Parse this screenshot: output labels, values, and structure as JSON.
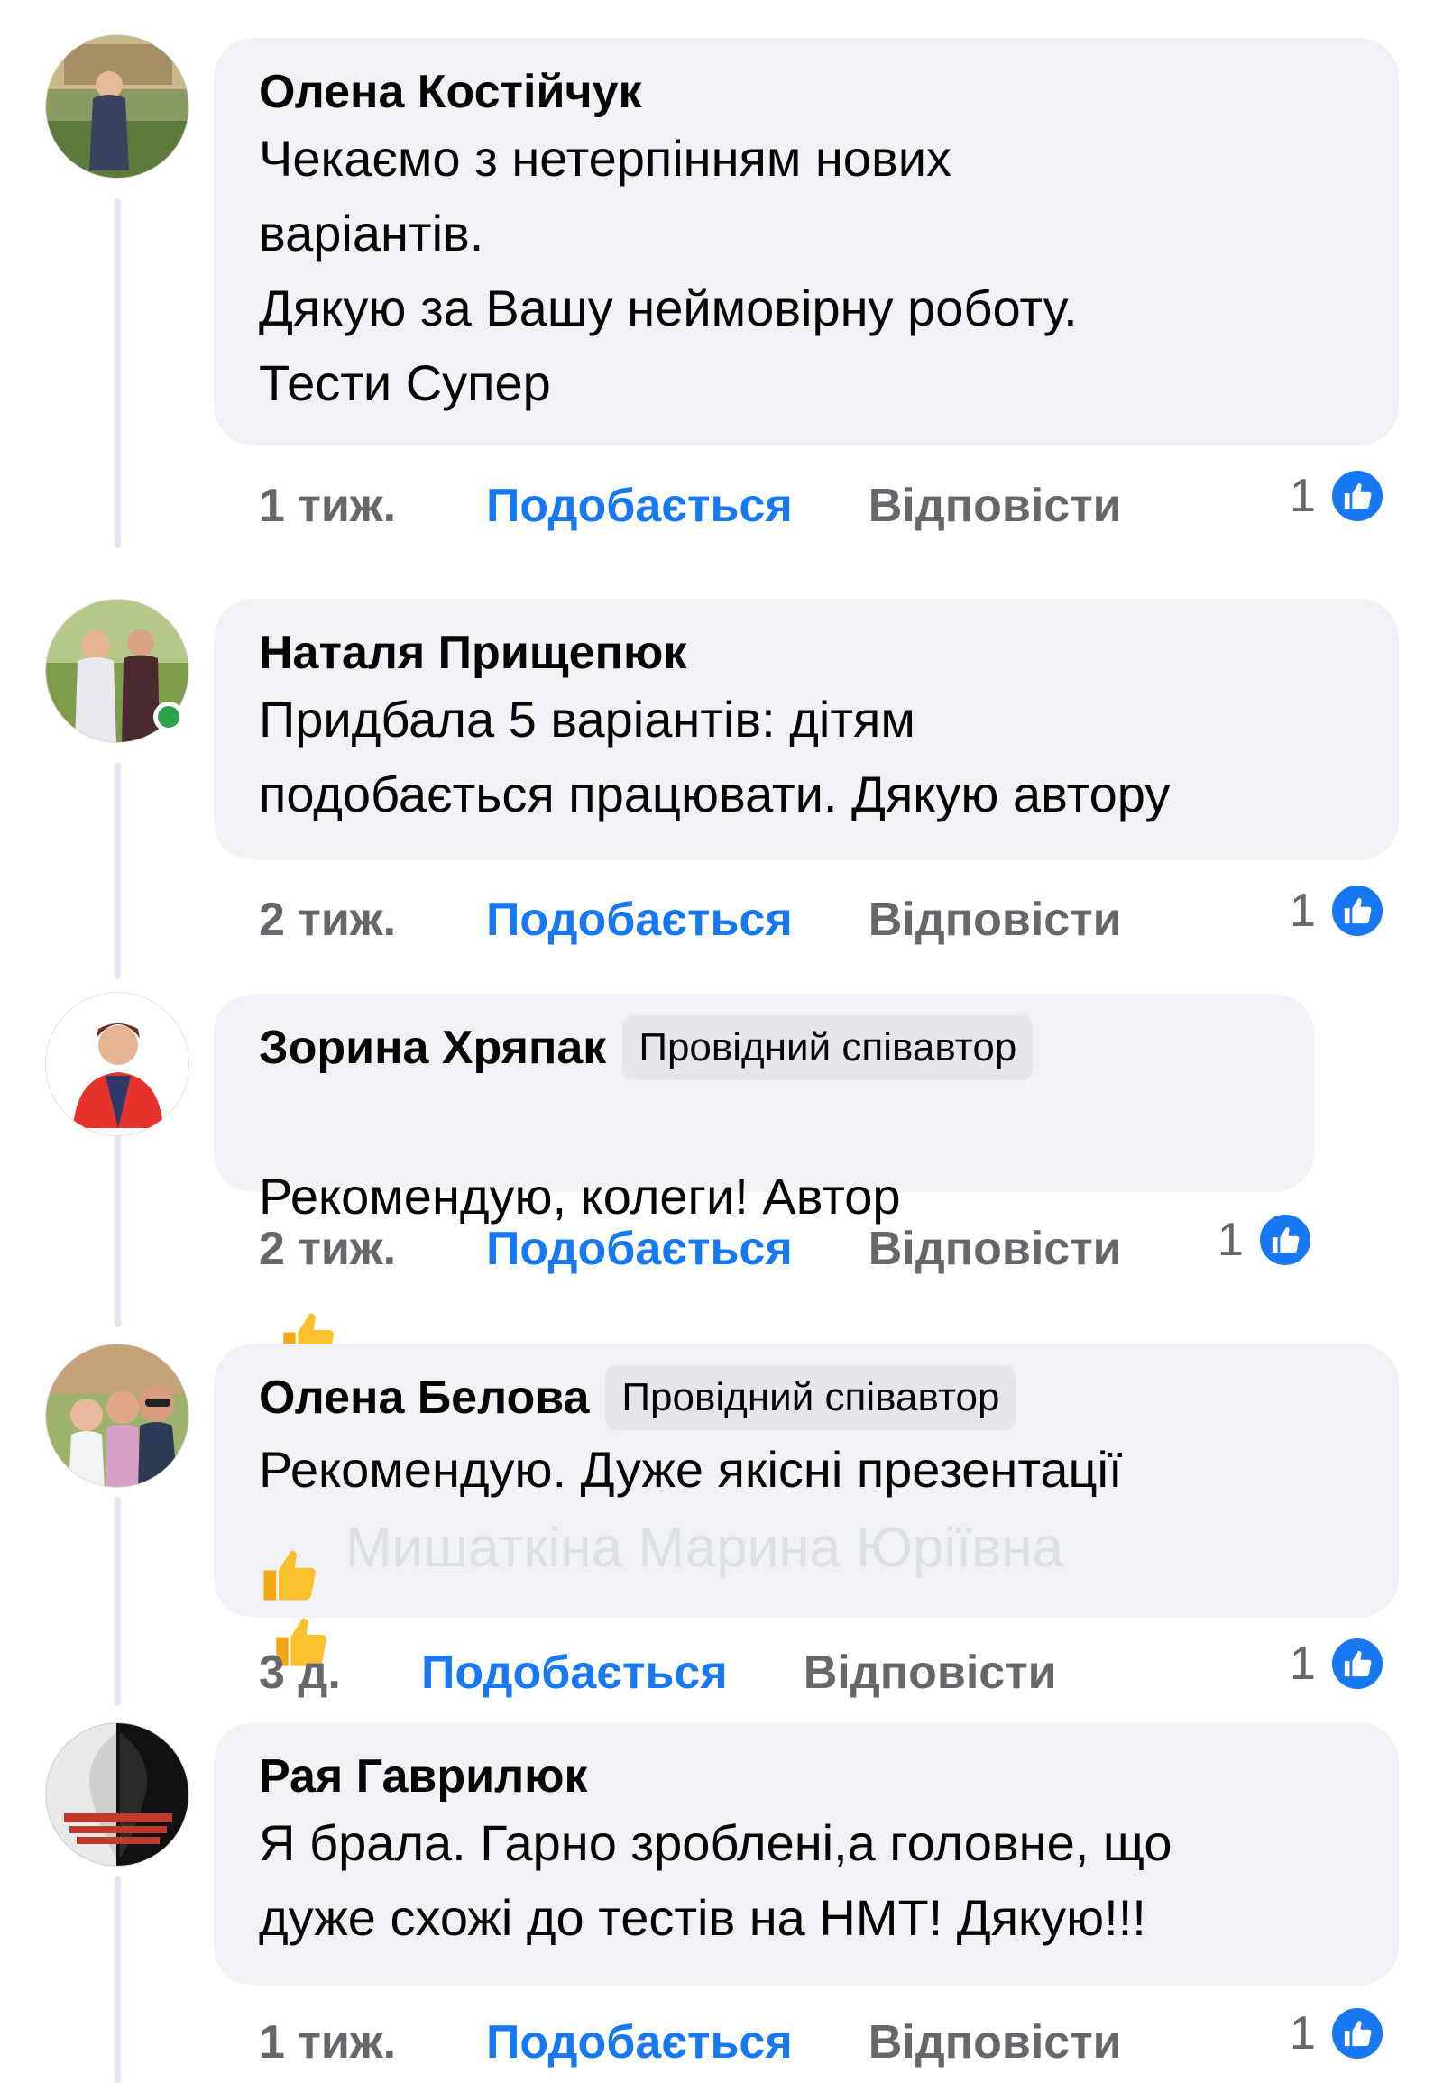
{
  "colors": {
    "like_blue": "#1877f2",
    "bubble_bg": "#f0f2f5",
    "meta_gray": "#65676b",
    "online_green": "#31a24c"
  },
  "comments": [
    {
      "author": "Олена Костійчук",
      "text": "Чекаємо з нетерпінням нових\nваріантів.\nДякую за Вашу неймовірну роботу.\nТести Супер",
      "time": "1 тиж.",
      "like_label": "Подобається",
      "reply_label": "Відповісти",
      "reaction_count": "1"
    },
    {
      "author": "Наталя Прищепюк",
      "text": "Придбала 5 варіантів: дітям\nподобається працювати. Дякую автору",
      "time": "2 тиж.",
      "like_label": "Подобається",
      "reply_label": "Відповісти",
      "reaction_count": "1",
      "online": true
    },
    {
      "author": "Зорина Хряпак",
      "badge": "Провідний співавтор",
      "text": "Рекомендую, колеги! Автор",
      "emoji": [
        "thumbs-up",
        "thumbs-up",
        "thumbs-up"
      ],
      "time": "2 тиж.",
      "like_label": "Подобається",
      "reply_label": "Відповісти",
      "reaction_count": "1"
    },
    {
      "author": "Олена Белова",
      "badge": "Провідний співавтор",
      "text": "Рекомендую. Дуже якісні презентації",
      "emoji": [
        "thumbs-up"
      ],
      "watermark": "Мишаткіна Марина Юріївна",
      "time": "3 д.",
      "like_label": "Подобається",
      "reply_label": "Відповісти",
      "reaction_count": "1"
    },
    {
      "author": "Рая Гаврилюк",
      "text": "Я брала. Гарно зроблені,а головне, що\nдуже схожі до тестів на НМТ! Дякую!!!",
      "time": "1 тиж.",
      "like_label": "Подобається",
      "reply_label": "Відповісти",
      "reaction_count": "1"
    }
  ]
}
